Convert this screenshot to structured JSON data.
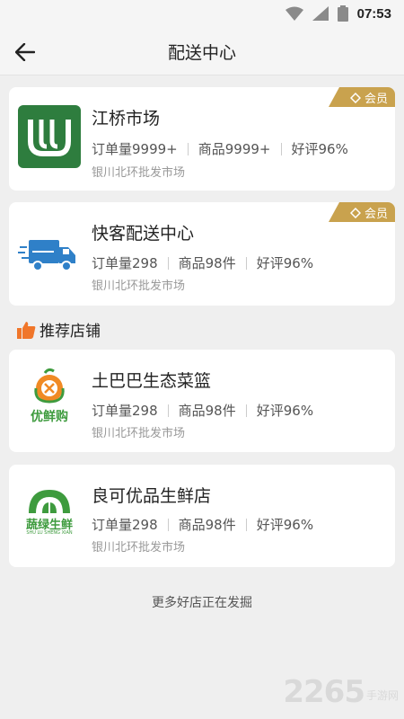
{
  "status_bar": {
    "time": "07:53"
  },
  "header": {
    "title": "配送中心"
  },
  "member_badge": "会员",
  "stores": [
    {
      "name": "江桥市场",
      "orders": "订单量9999+",
      "products": "商品9999+",
      "rating": "好评96%",
      "address": "银川北环批发市场"
    },
    {
      "name": "快客配送中心",
      "orders": "订单量298",
      "products": "商品98件",
      "rating": "好评96%",
      "address": "银川北环批发市场"
    }
  ],
  "recommended": {
    "title": "推荐店铺",
    "stores": [
      {
        "name": "土巴巴生态菜篮",
        "logo_text": "优鲜购",
        "orders": "订单量298",
        "products": "商品98件",
        "rating": "好评96%",
        "address": "银川北环批发市场"
      },
      {
        "name": "良可优品生鲜店",
        "logo_text": "蔬绿生鲜",
        "logo_subtext": "SHU LU SHENG XIAN",
        "orders": "订单量298",
        "products": "商品98件",
        "rating": "好评96%",
        "address": "银川北环批发市场"
      }
    ]
  },
  "footer": {
    "text": "更多好店正在发掘"
  },
  "watermark": {
    "number": "2265",
    "text": "手游网"
  },
  "colors": {
    "gold_badge": "#c9a24e",
    "logo_green": "#2e7d3e",
    "truck_blue": "#2f80c8",
    "thumb_orange": "#f0762a"
  }
}
